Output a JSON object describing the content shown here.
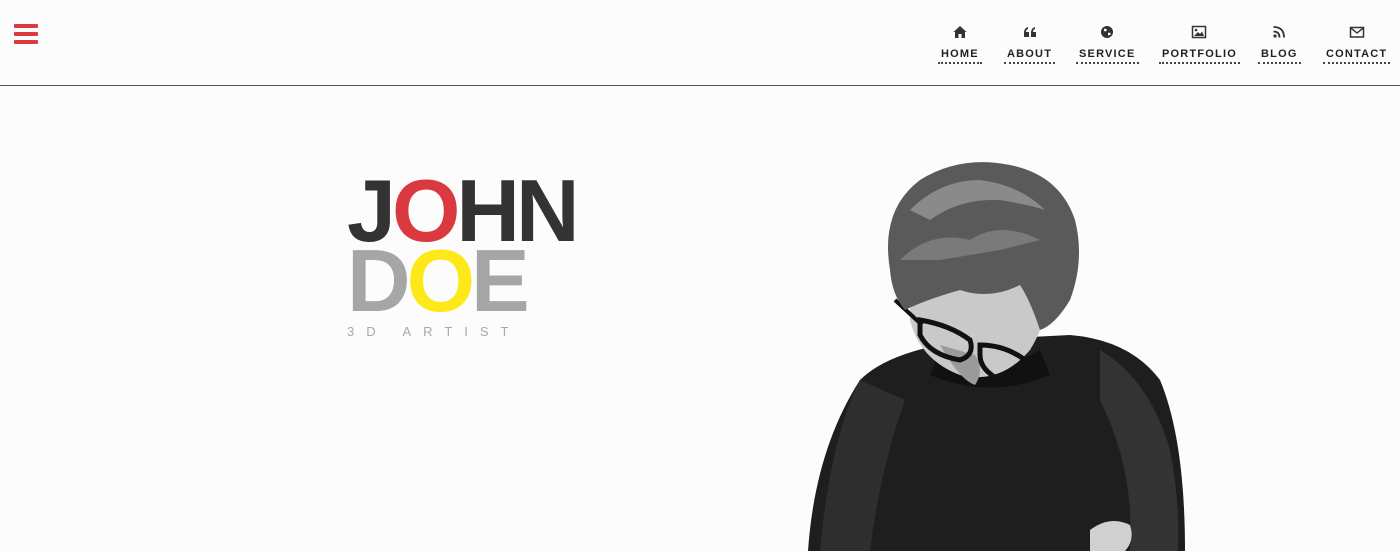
{
  "header": {
    "menu_icon": "hamburger-menu-icon",
    "accent_color": "#d9393f"
  },
  "nav": {
    "items": [
      {
        "label": "HOME",
        "icon": "home-icon"
      },
      {
        "label": "ABOUT",
        "icon": "quote-icon"
      },
      {
        "label": "SERVICE",
        "icon": "globe-icon"
      },
      {
        "label": "PORTFOLIO",
        "icon": "image-icon"
      },
      {
        "label": "BLOG",
        "icon": "rss-icon"
      },
      {
        "label": "CONTACT",
        "icon": "envelope-icon"
      }
    ]
  },
  "hero": {
    "first_name": {
      "part1": "J",
      "part2": "O",
      "part3": "HN"
    },
    "last_name": {
      "part1": "D",
      "part2": "O",
      "part3": "E"
    },
    "tagline": "3D ARTIST",
    "colors": {
      "dark": "#333333",
      "red": "#d9393f",
      "grey": "#a6a6a6",
      "yellow": "#ffe81a"
    }
  }
}
